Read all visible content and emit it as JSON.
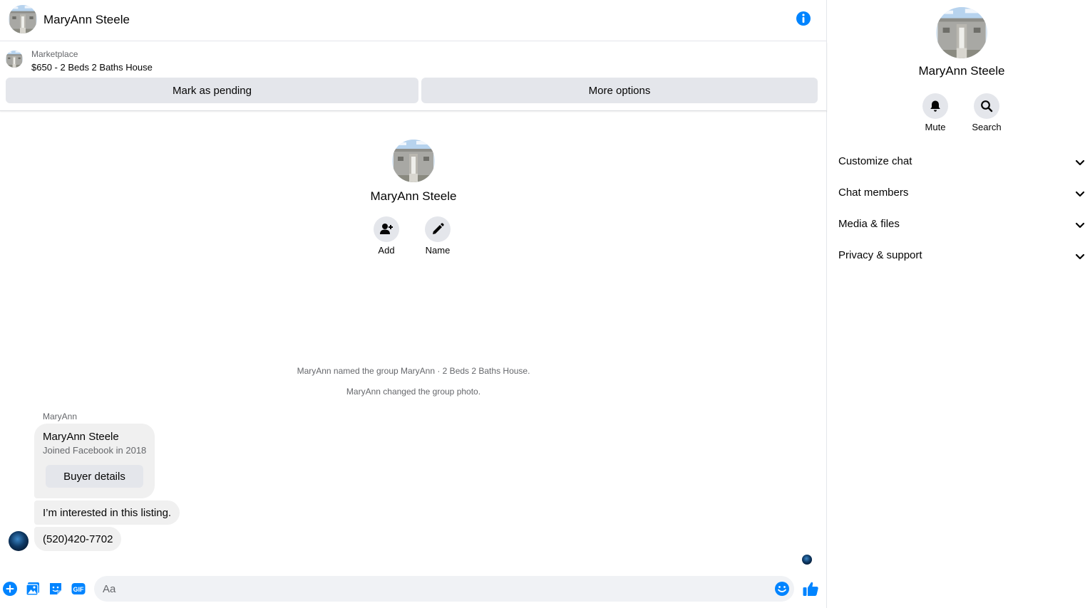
{
  "conversation": {
    "name": "MaryAnn Steele"
  },
  "marketplace": {
    "label": "Marketplace",
    "listing": "$650 - 2 Beds 2 Baths House",
    "mark_pending_label": "Mark as pending",
    "more_options_label": "More options"
  },
  "intro": {
    "name": "MaryAnn Steele",
    "add_label": "Add",
    "name_label": "Name"
  },
  "system_messages": [
    "MaryAnn named the group MaryAnn · 2 Beds 2 Baths House.",
    "MaryAnn changed the group photo."
  ],
  "messages": {
    "sender": "MaryAnn",
    "card": {
      "name": "MaryAnn Steele",
      "subtitle": "Joined Facebook in 2018",
      "button": "Buyer details"
    },
    "texts": [
      "I’m interested in this listing.",
      "(520)420-7702"
    ]
  },
  "composer": {
    "placeholder": "Aa"
  },
  "panel": {
    "name": "MaryAnn Steele",
    "mute_label": "Mute",
    "search_label": "Search",
    "sections": [
      "Customize chat",
      "Chat members",
      "Media & files",
      "Privacy & support"
    ]
  },
  "colors": {
    "accent": "#0084ff",
    "button_bg": "#e4e6eb",
    "bubble_bg": "#f0f0f0",
    "secondary_text": "#65676b"
  },
  "icons": {
    "header": "info-icon",
    "composer": [
      "plus-circle-icon",
      "image-icon",
      "sticker-icon",
      "gif-icon",
      "emoji-icon",
      "thumbs-up-icon"
    ],
    "intro": [
      "add-person-icon",
      "pencil-icon"
    ],
    "panel": [
      "bell-icon",
      "search-icon",
      "chevron-down-icon"
    ]
  }
}
